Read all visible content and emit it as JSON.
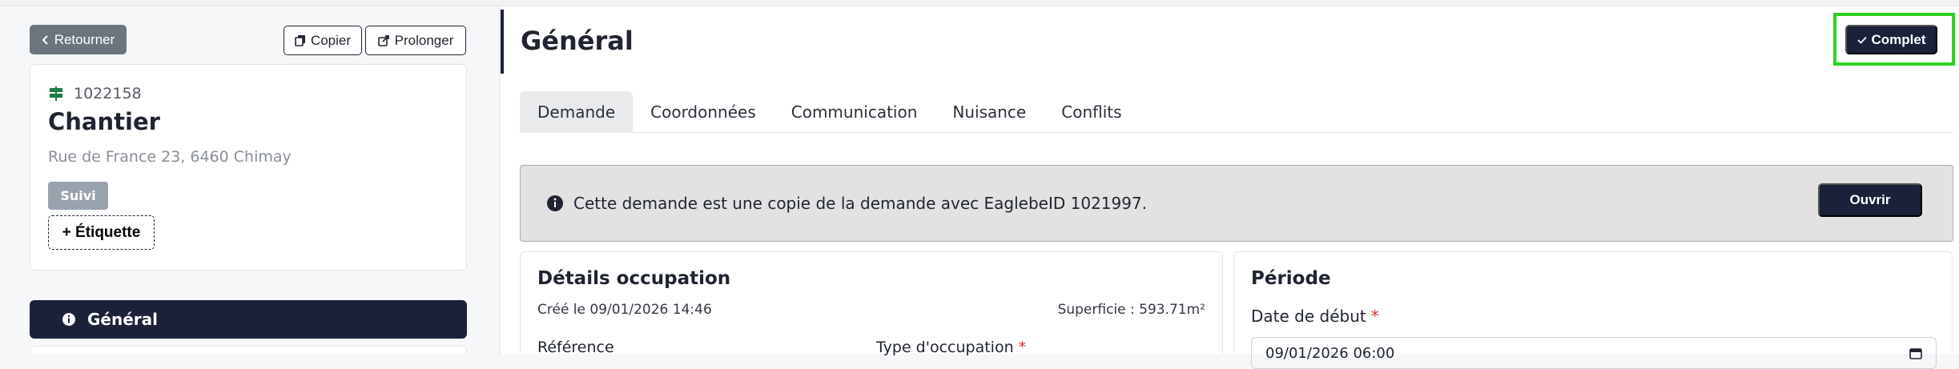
{
  "sidebar": {
    "back_label": "Retourner",
    "copy_label": "Copier",
    "extend_label": "Prolonger",
    "card": {
      "id": "1022158",
      "title": "Chantier",
      "address": "Rue de France 23, 6460 Chimay",
      "status": "Suivi",
      "add_tag_label": "+ Étiquette"
    },
    "nav": {
      "general_label": "Général"
    }
  },
  "main": {
    "title": "Général",
    "complete_label": "Complet",
    "tabs": [
      {
        "label": "Demande"
      },
      {
        "label": "Coordonnées"
      },
      {
        "label": "Communication"
      },
      {
        "label": "Nuisance"
      },
      {
        "label": "Conflits"
      }
    ],
    "active_tab": "Demande",
    "notice": {
      "text": "Cette demande est une copie de la demande avec EaglebeID 1021997.",
      "button_label": "Ouvrir"
    },
    "details": {
      "title": "Détails occupation",
      "created": "Créé le 09/01/2026 14:46",
      "area": "Superficie : 593.71m²",
      "reference_label": "Référence",
      "occupation_type_label": "Type d'occupation"
    },
    "period": {
      "title": "Période",
      "start_date_label": "Date de début",
      "start_date_value": "09/01/2026 06:00"
    }
  },
  "colors": {
    "primary": "#1a2138",
    "secondary": "#6c757d",
    "highlight": "#2ed321",
    "required": "#d0312d"
  }
}
